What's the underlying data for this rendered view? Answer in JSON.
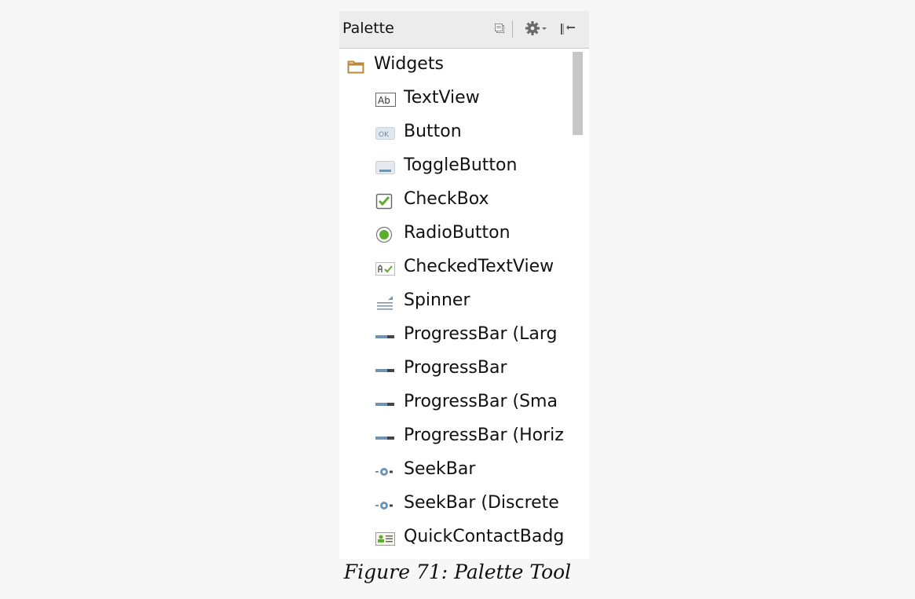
{
  "palette": {
    "title": "Palette",
    "header_icons": [
      "restore-icon",
      "gear-icon",
      "hide-panel-icon"
    ],
    "group": {
      "label": "Widgets",
      "icon": "folder-icon",
      "items": [
        {
          "label": "TextView",
          "icon": "textview-icon"
        },
        {
          "label": "Button",
          "icon": "button-icon"
        },
        {
          "label": "ToggleButton",
          "icon": "togglebutton-icon"
        },
        {
          "label": "CheckBox",
          "icon": "checkbox-icon"
        },
        {
          "label": "RadioButton",
          "icon": "radiobutton-icon"
        },
        {
          "label": "CheckedTextView",
          "icon": "checkedtextview-icon"
        },
        {
          "label": "Spinner",
          "icon": "spinner-icon"
        },
        {
          "label": "ProgressBar (Larg",
          "icon": "progressbar-icon"
        },
        {
          "label": "ProgressBar",
          "icon": "progressbar-icon"
        },
        {
          "label": "ProgressBar (Sma",
          "icon": "progressbar-icon"
        },
        {
          "label": "ProgressBar (Horiz",
          "icon": "progressbar-icon"
        },
        {
          "label": "SeekBar",
          "icon": "seekbar-icon"
        },
        {
          "label": "SeekBar (Discrete",
          "icon": "seekbar-icon"
        },
        {
          "label": "QuickContactBadg",
          "icon": "quickcontactbadge-icon"
        }
      ]
    }
  },
  "caption": "Figure 71: Palette Tool",
  "colors": {
    "folder": "#b88a3c",
    "check_green": "#5aae2b",
    "progress_blue": "#6e95b3"
  }
}
